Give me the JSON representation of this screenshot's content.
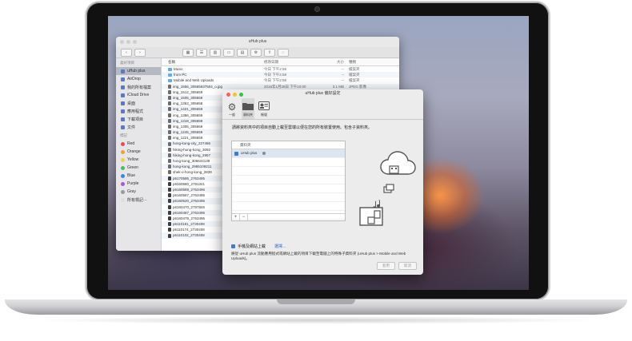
{
  "finder": {
    "title": "uHub plus",
    "sidebar_heading_favorites": "喜好項目",
    "sidebar_heading_tags": "標記",
    "favorites": [
      {
        "label": "uHub plus",
        "icon": "folder-icon",
        "selected": true
      },
      {
        "label": "AirDrop",
        "icon": "airdrop-icon"
      },
      {
        "label": "我的所有檔案",
        "icon": "all-files-icon"
      },
      {
        "label": "iCloud Drive",
        "icon": "cloud-icon"
      },
      {
        "label": "桌面",
        "icon": "desktop-icon"
      },
      {
        "label": "應用程式",
        "icon": "apps-icon"
      },
      {
        "label": "下載項目",
        "icon": "download-icon"
      },
      {
        "label": "文件",
        "icon": "document-icon"
      }
    ],
    "tags": [
      {
        "label": "Red",
        "color": "#f04a4a"
      },
      {
        "label": "Orange",
        "color": "#f5a030"
      },
      {
        "label": "Yellow",
        "color": "#f2d040"
      },
      {
        "label": "Green",
        "color": "#46c15a"
      },
      {
        "label": "Blue",
        "color": "#3a86e8"
      },
      {
        "label": "Purple",
        "color": "#a65ad0"
      },
      {
        "label": "Gray",
        "color": "#9a9a9a"
      },
      {
        "label": "所有標記⋯",
        "color": "#dddddd"
      }
    ],
    "columns": {
      "name": "名稱",
      "date": "修改日期",
      "size": "大小",
      "kind": "種類"
    },
    "files": [
      {
        "name": "Music",
        "date": "今日 下午2:58",
        "size": "--",
        "kind": "檔案夾",
        "type": "folder"
      },
      {
        "name": "from PC",
        "date": "今日 下午2:58",
        "size": "--",
        "kind": "檔案夾",
        "type": "folder"
      },
      {
        "name": "Mobile and Web Uploads",
        "date": "今日 下午2:58",
        "size": "--",
        "kind": "檔案夾",
        "type": "folder"
      },
      {
        "name": "img_1556_30565637504_o.jpg",
        "date": "2016年1月28日 下午10:00",
        "size": "3.1 MB",
        "kind": "JPEG 影像",
        "type": "image"
      },
      {
        "name": "img_1512_305659",
        "date": "",
        "size": "",
        "kind": "",
        "type": "image"
      },
      {
        "name": "img_1505_305659",
        "date": "",
        "size": "",
        "kind": "",
        "type": "image"
      },
      {
        "name": "img_1363_305658",
        "date": "",
        "size": "",
        "kind": "",
        "type": "image"
      },
      {
        "name": "img_1421_305659",
        "date": "",
        "size": "",
        "kind": "",
        "type": "image"
      },
      {
        "name": "img_1386_305659",
        "date": "",
        "size": "",
        "kind": "",
        "type": "image"
      },
      {
        "name": "img_1318_305659",
        "date": "",
        "size": "",
        "kind": "",
        "type": "image"
      },
      {
        "name": "img_1305_305659",
        "date": "",
        "size": "",
        "kind": "",
        "type": "image"
      },
      {
        "name": "img_1245_305659",
        "date": "",
        "size": "",
        "kind": "",
        "type": "image"
      },
      {
        "name": "img_1221_305659",
        "date": "",
        "size": "",
        "kind": "",
        "type": "image"
      },
      {
        "name": "hong-kong-city_227466",
        "date": "",
        "size": "",
        "kind": "",
        "type": "image"
      },
      {
        "name": "hiking-hong-kong_3092",
        "date": "",
        "size": "",
        "kind": "",
        "type": "image"
      },
      {
        "name": "hiking-hong-kong_2957",
        "date": "",
        "size": "",
        "kind": "",
        "type": "image"
      },
      {
        "name": "hong-kong_306644139",
        "date": "",
        "size": "",
        "kind": "",
        "type": "image"
      },
      {
        "name": "hong-kong_2995109211",
        "date": "",
        "size": "",
        "kind": "",
        "type": "image"
      },
      {
        "name": "shek-o-hong-kong_2839",
        "date": "",
        "size": "",
        "kind": "",
        "type": "image"
      },
      {
        "name": "p6170586_2763495",
        "date": "",
        "size": "",
        "kind": "",
        "type": "video"
      },
      {
        "name": "p6160580_2781341",
        "date": "",
        "size": "",
        "kind": "",
        "type": "video"
      },
      {
        "name": "p6160588_2763496",
        "date": "",
        "size": "",
        "kind": "",
        "type": "video"
      },
      {
        "name": "p6160587_2763495",
        "date": "",
        "size": "",
        "kind": "",
        "type": "video"
      },
      {
        "name": "p6160520_2763495",
        "date": "",
        "size": "",
        "kind": "",
        "type": "video"
      },
      {
        "name": "p6160470_2787846",
        "date": "",
        "size": "",
        "kind": "",
        "type": "video"
      },
      {
        "name": "p6160487_2763495",
        "date": "",
        "size": "",
        "kind": "",
        "type": "video"
      },
      {
        "name": "p6160479_2763495",
        "date": "",
        "size": "",
        "kind": "",
        "type": "video"
      },
      {
        "name": "p6110181_2730408",
        "date": "",
        "size": "",
        "kind": "",
        "type": "video"
      },
      {
        "name": "p6110174_2730408",
        "date": "",
        "size": "",
        "kind": "",
        "type": "video"
      },
      {
        "name": "p6110102_2730408",
        "date": "",
        "size": "",
        "kind": "",
        "type": "video"
      }
    ]
  },
  "prefs": {
    "title": "uHub plus 偏好設定",
    "tabs": [
      {
        "label": "一般",
        "icon": "gear-icon"
      },
      {
        "label": "資料夾",
        "icon": "folder-icon",
        "selected": true
      },
      {
        "label": "帳號",
        "icon": "account-icon"
      }
    ],
    "description": "請將資料夾中的項目自動上載至雲端以便在您的所有裝置使用。包含子資料夾。",
    "table_header": "資料夾",
    "table_row": "uHub plus",
    "add_symbol": "+",
    "remove_symbol": "−",
    "option_label": "手機及網站上載",
    "option_link": "選擇...",
    "option_description": "將從 uHub plus 流動應用程式或網站上載的項目下載至電腦上的特殊子資料夾 (uHub plus > Mobile and Web Uploads)。",
    "apply_label": "套用",
    "cancel_label": "取消"
  }
}
